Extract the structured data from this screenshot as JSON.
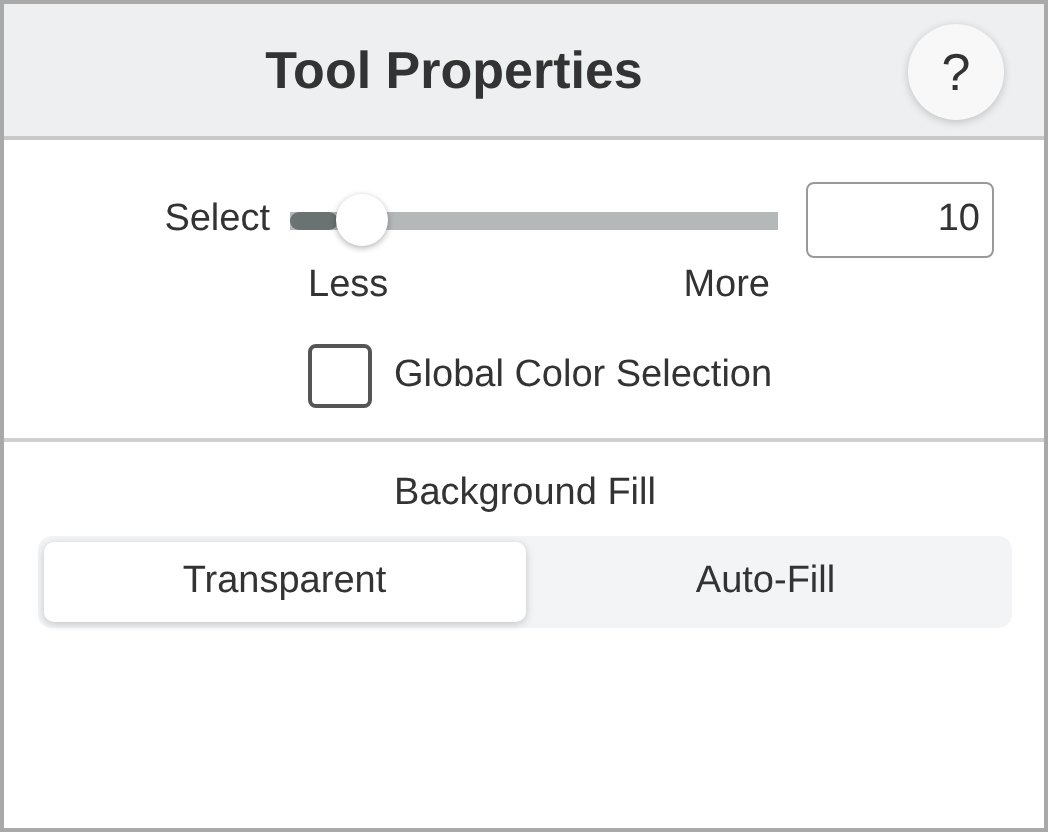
{
  "header": {
    "title": "Tool Properties",
    "help_button": "?"
  },
  "select": {
    "label": "Select",
    "level": 0.1,
    "value": "10",
    "min_label": "Less",
    "max_label": "More"
  },
  "global_color_selection": {
    "label": "Global Color Selection",
    "checked": false
  },
  "background_fill": {
    "label": "Background Fill",
    "options": [
      {
        "label": "Transparent",
        "selected": true
      },
      {
        "label": "Auto-Fill",
        "selected": false
      }
    ]
  }
}
